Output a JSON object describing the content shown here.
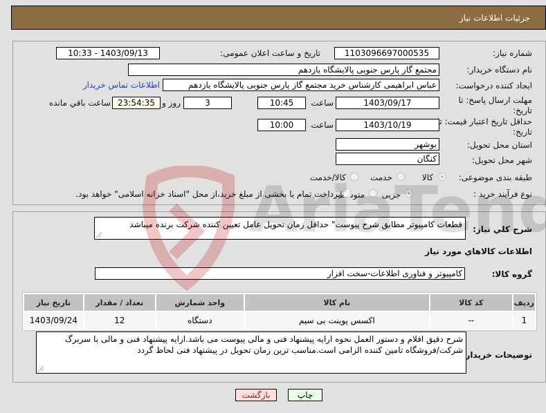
{
  "header": {
    "title": "جزئیات اطلاعات نیاز"
  },
  "form": {
    "need_number": {
      "label": "شماره نیاز:",
      "value": "1103096697000535"
    },
    "announce_datetime": {
      "label": "تاریخ و ساعت اعلان عمومی:",
      "value": "1403/09/13 - 10:33"
    },
    "buyer_org": {
      "label": "نام دستگاه خریدار:",
      "value": "مجتمع گاز پارس جنوبی  پالایشگاه یازدهم"
    },
    "requester": {
      "label": "ایجاد کننده درخواست:",
      "value": "عباس ابراهیمی کارشناس خرید مجتمع گاز پارس جنوبی  پالایشگاه یازدهم",
      "contact_link": "اطلاعات تماس خریدار"
    },
    "response_deadline": {
      "label": "مهلت ارسال پاسخ: تا تاریخ:",
      "date": "1403/09/17",
      "time_label": "ساعت",
      "time": "10:45",
      "days": "3",
      "days_label": "روز و",
      "remaining": "23:54:35",
      "remaining_label": "ساعت باقي مانده"
    },
    "price_validity": {
      "label": "حداقل تاریخ اعتبار قیمت: تا تاریخ:",
      "date": "1403/10/19",
      "time_label": "ساعت",
      "time": "10:00"
    },
    "province": {
      "label": "استان محل تحویل:",
      "value": "بوشهر"
    },
    "city": {
      "label": "شهر محل تحویل:",
      "value": "کنگان"
    },
    "category": {
      "label": "طبقه بندی موضوعی:",
      "options": [
        "کالا",
        "خدمت",
        "کالا/خدمت"
      ],
      "selected": "کالا"
    },
    "purchase_type": {
      "label": "نوع فرآیند خرید :",
      "options": [
        "جزیی",
        "متوسط"
      ],
      "selected": "جزیی",
      "treasury_note": "پرداخت تمام یا بخشی از مبلغ خرید،از محل \"اسناد خزانه اسلامی\" خواهد بود."
    }
  },
  "summary": {
    "label": "شرح کلي نیاز:",
    "value": "قطعات کامپیوتر مطابق شرح پیوست\" حداقل زمان تحویل عامل تعیین کننده شرکت برنده میباشد"
  },
  "items_section": {
    "title": "اطلاعات کالاهاي مورد نیاز",
    "group_label": "گروه کالا:",
    "group_value": "کامپیوتر و فناوری اطلاعات-سخت افزار",
    "columns": [
      "ردیف",
      "کد کالا",
      "نام کالا",
      "واحد شمارش",
      "تعداد / مقدار",
      "تاریخ نیاز"
    ],
    "rows": [
      [
        "1",
        "--",
        "اکسس پوینت بی سیم",
        "دستگاه",
        "12",
        "1403/09/24"
      ]
    ]
  },
  "buyer_notes": {
    "label": "توضیحات خریدار:",
    "value": "شرح دقیق اقلام و دستور العمل نحوه ارایه پیشنهاد فنی و مالی پیوست می باشد.ارایه پیشنهاد فنی و مالی با سربرگ شرکت/فروشگاه تامین کننده الزامی است.مناسب ترین زمان تحویل در پیشنهاد فنی لحاظ گردد"
  },
  "buttons": {
    "print": "چاپ",
    "back": "بازگشت"
  },
  "watermark": {
    "text": "AriaTender.neT"
  },
  "colors": {
    "header_bg": "#8b6b42",
    "print_bg": "#eaffea",
    "back_bg": "#ffdede",
    "link": "#2a3cc6"
  }
}
